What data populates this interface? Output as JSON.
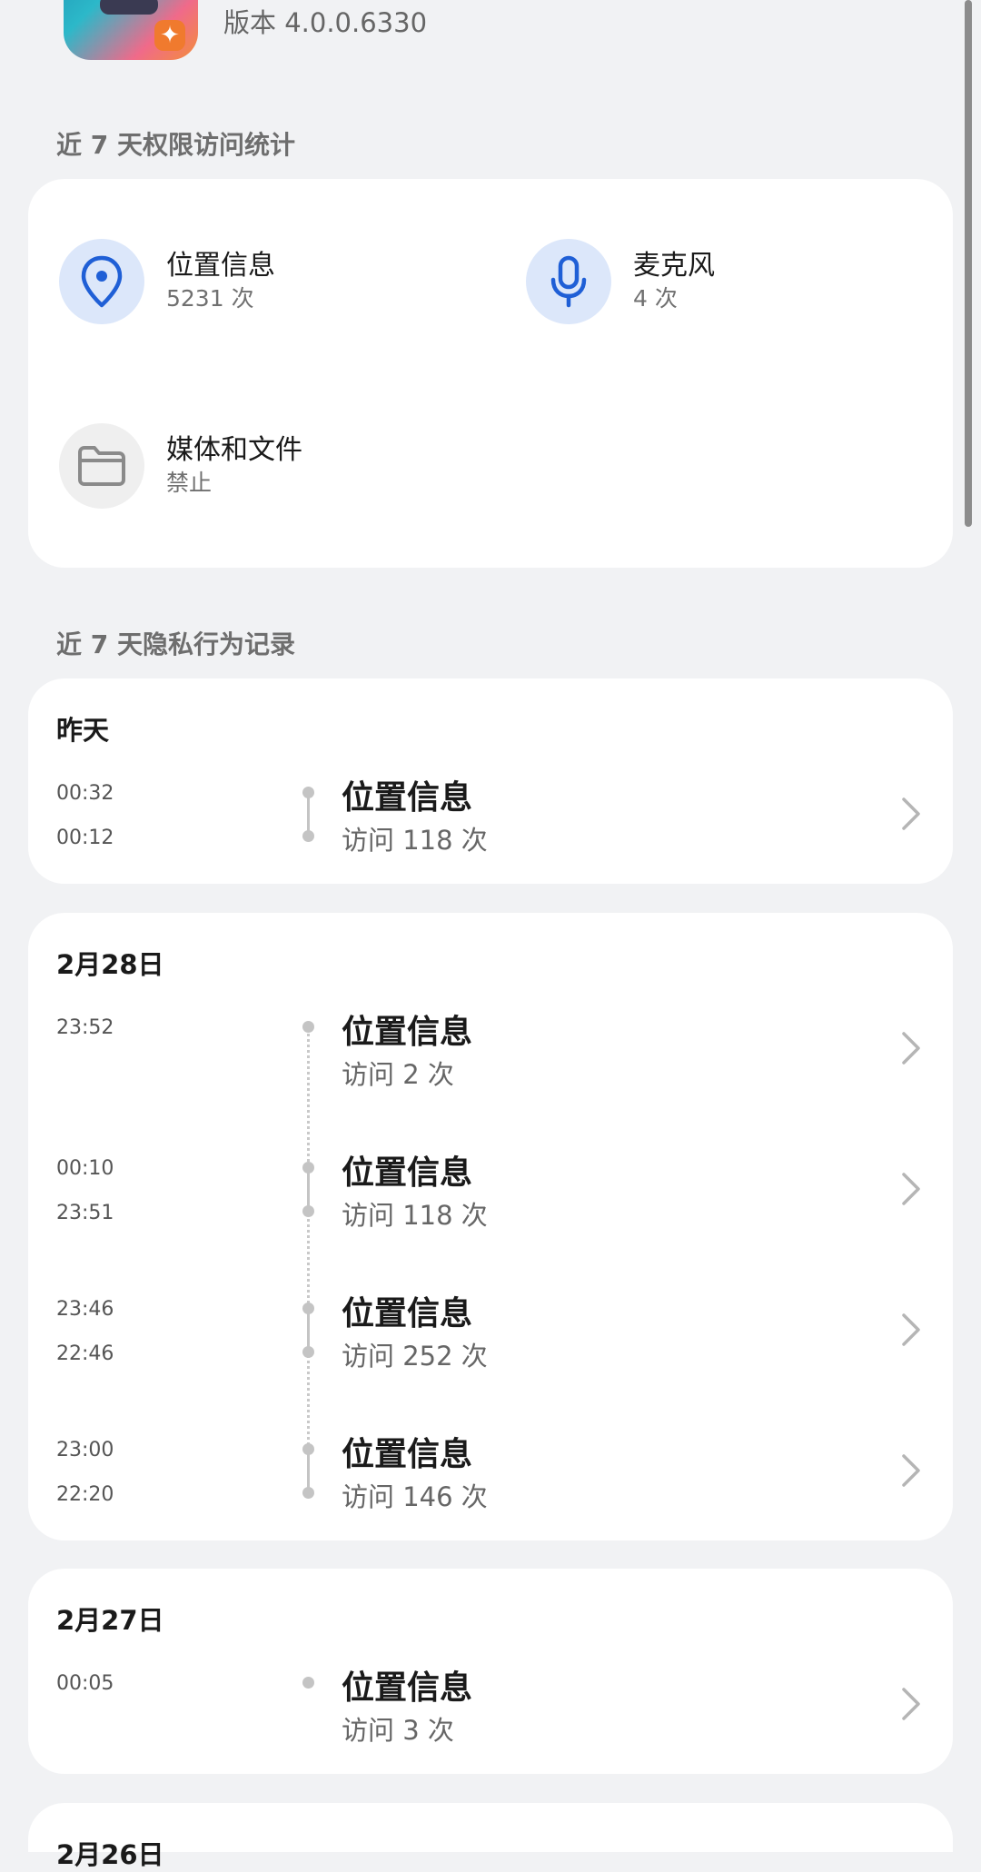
{
  "app": {
    "version": "版本 4.0.0.6330",
    "icon": "app-icon"
  },
  "stats_section": {
    "label": "近 7 天权限访问统计",
    "permissions": [
      {
        "name": "位置信息",
        "count": "5231 次",
        "icon": "location-pin-icon"
      },
      {
        "name": "麦克风",
        "count": "4 次",
        "icon": "microphone-icon"
      },
      {
        "name": "媒体和文件",
        "count": "禁止",
        "icon": "folder-icon"
      }
    ]
  },
  "records_section": {
    "label": "近 7 天隐私行为记录",
    "days": [
      {
        "date": "昨天",
        "entries": [
          {
            "time_start": "00:32",
            "time_end": "00:12",
            "title": "位置信息",
            "sub": "访问 118 次"
          }
        ]
      },
      {
        "date": "2月28日",
        "entries": [
          {
            "time_start": "23:52",
            "time_end": "",
            "title": "位置信息",
            "sub": "访问 2 次"
          },
          {
            "time_start": "00:10",
            "time_end": "23:51",
            "title": "位置信息",
            "sub": "访问 118 次"
          },
          {
            "time_start": "23:46",
            "time_end": "22:46",
            "title": "位置信息",
            "sub": "访问 252 次"
          },
          {
            "time_start": "23:00",
            "time_end": "22:20",
            "title": "位置信息",
            "sub": "访问 146 次"
          }
        ]
      },
      {
        "date": "2月27日",
        "entries": [
          {
            "time_start": "00:05",
            "time_end": "",
            "title": "位置信息",
            "sub": "访问 3 次"
          }
        ]
      },
      {
        "date": "2月26日",
        "entries": []
      }
    ]
  },
  "colors": {
    "accent_blue": "#1f5fd6",
    "icon_bg_blue": "#dce7fa",
    "page_bg": "#f1f2f4"
  }
}
